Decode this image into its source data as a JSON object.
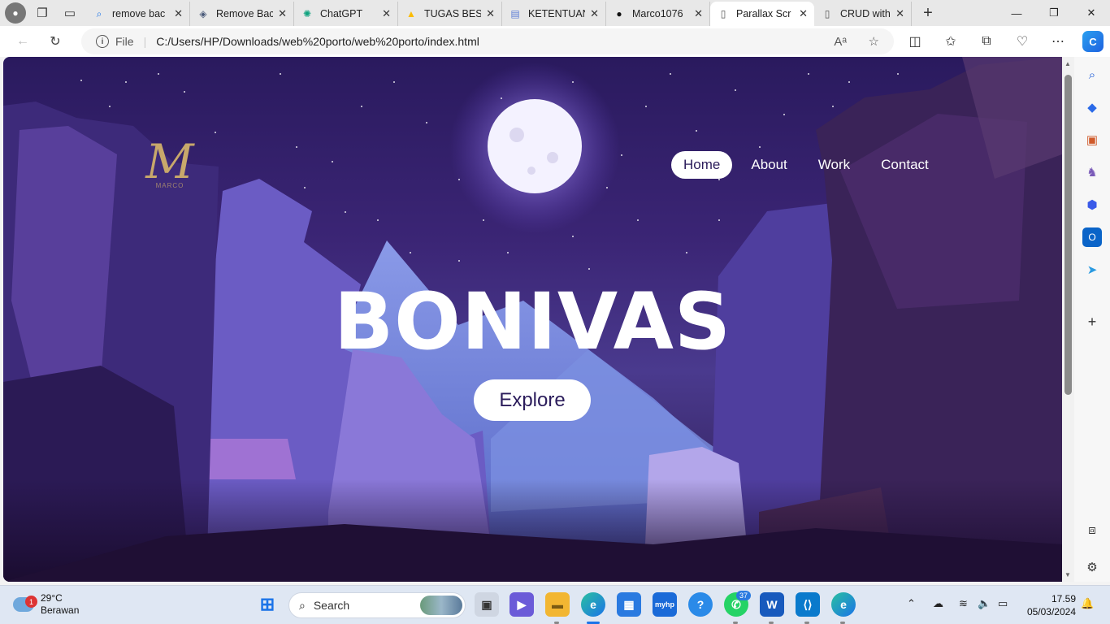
{
  "browser": {
    "tabs": [
      {
        "title": "remove bac",
        "favicon": "search-icon",
        "color": "#1a73e8"
      },
      {
        "title": "Remove Bac",
        "favicon": "layers-icon",
        "color": "#4a5a7a"
      },
      {
        "title": "ChatGPT",
        "favicon": "chatgpt-icon",
        "color": "#10a37f"
      },
      {
        "title": "TUGAS BES",
        "favicon": "google-drive-icon",
        "color": "#fbbc04"
      },
      {
        "title": "KETENTUAN",
        "favicon": "docs-icon",
        "color": "#5b7bd5"
      },
      {
        "title": "Marco1076",
        "favicon": "github-icon",
        "color": "#111111"
      },
      {
        "title": "Parallax Scr",
        "favicon": "page-icon",
        "color": "#555555",
        "active": true
      },
      {
        "title": "CRUD with",
        "favicon": "page-icon",
        "color": "#555555"
      }
    ],
    "address": {
      "scheme_label": "File",
      "url": "C:/Users/HP/Downloads/web%20porto/web%20porto/index.html"
    }
  },
  "page": {
    "logo_letter": "M",
    "logo_name": "MARCO",
    "nav": [
      "Home",
      "About",
      "Work",
      "Contact"
    ],
    "active_nav": "Home",
    "hero_title": "BONIVAS",
    "cta_label": "Explore"
  },
  "taskbar": {
    "weather": {
      "temp": "29°C",
      "condition": "Berawan",
      "alert_count": "1"
    },
    "search_placeholder": "Search",
    "whatsapp_badge": "37",
    "time": "17.59",
    "date": "05/03/2024"
  },
  "colors": {
    "sky_top": "#2a1a5e",
    "accent_purple": "#2b1c5b",
    "logo_gold": "#c8a86b",
    "edge_blue": "#1a73e8"
  }
}
